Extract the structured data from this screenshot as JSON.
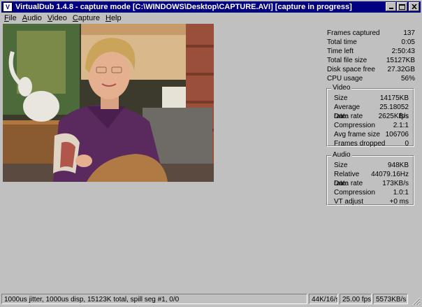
{
  "window": {
    "title": "VirtualDub 1.4.8 - capture mode [C:\\WINDOWS\\Desktop\\CAPTURE.AVI] [capture in progress]"
  },
  "menu": [
    {
      "label": "File",
      "underline": "F",
      "rest": "ile"
    },
    {
      "label": "Audio",
      "underline": "A",
      "rest": "udio"
    },
    {
      "label": "Video",
      "underline": "V",
      "rest": "ideo"
    },
    {
      "label": "Capture",
      "underline": "C",
      "rest": "apture"
    },
    {
      "label": "Help",
      "underline": "H",
      "rest": "elp"
    }
  ],
  "stats": {
    "frames_captured": {
      "label": "Frames captured",
      "value": "137"
    },
    "total_time": {
      "label": "Total time",
      "value": "0:05"
    },
    "time_left": {
      "label": "Time left",
      "value": "2:50:43"
    },
    "total_file_size": {
      "label": "Total file size",
      "value": "15127KB"
    },
    "disk_space_free": {
      "label": "Disk space free",
      "value": "27.32GB"
    },
    "cpu_usage": {
      "label": "CPU usage",
      "value": "56%"
    }
  },
  "video_group": {
    "title": "Video",
    "rows": [
      {
        "label": "Size",
        "value": "14175KB"
      },
      {
        "label": "Average rate",
        "value": "25.18052 fps"
      },
      {
        "label": "Data rate",
        "value": "2625KB/s"
      },
      {
        "label": "Compression",
        "value": "2.1:1"
      },
      {
        "label": "Avg frame size",
        "value": "106706"
      },
      {
        "label": "Frames dropped",
        "value": "0"
      }
    ]
  },
  "audio_group": {
    "title": "Audio",
    "rows": [
      {
        "label": "Size",
        "value": "948KB"
      },
      {
        "label": "Relative rate",
        "value": "44079.16Hz"
      },
      {
        "label": "Data rate",
        "value": "173KB/s"
      },
      {
        "label": "Compression",
        "value": "1.0:1"
      },
      {
        "label": "VT adjust",
        "value": "+0 ms"
      }
    ]
  },
  "statusbar": {
    "main": "1000us jitter, 1000us disp, 15123K total, spill seg #1, 0/0",
    "audio_format": "44K/16/s",
    "fps": "25.00 fps",
    "data_rate": "5573KB/s"
  },
  "icons": {
    "app": "virtualdub-app-icon",
    "minimize": "minimize-icon",
    "maximize": "maximize-icon",
    "close": "close-icon"
  }
}
